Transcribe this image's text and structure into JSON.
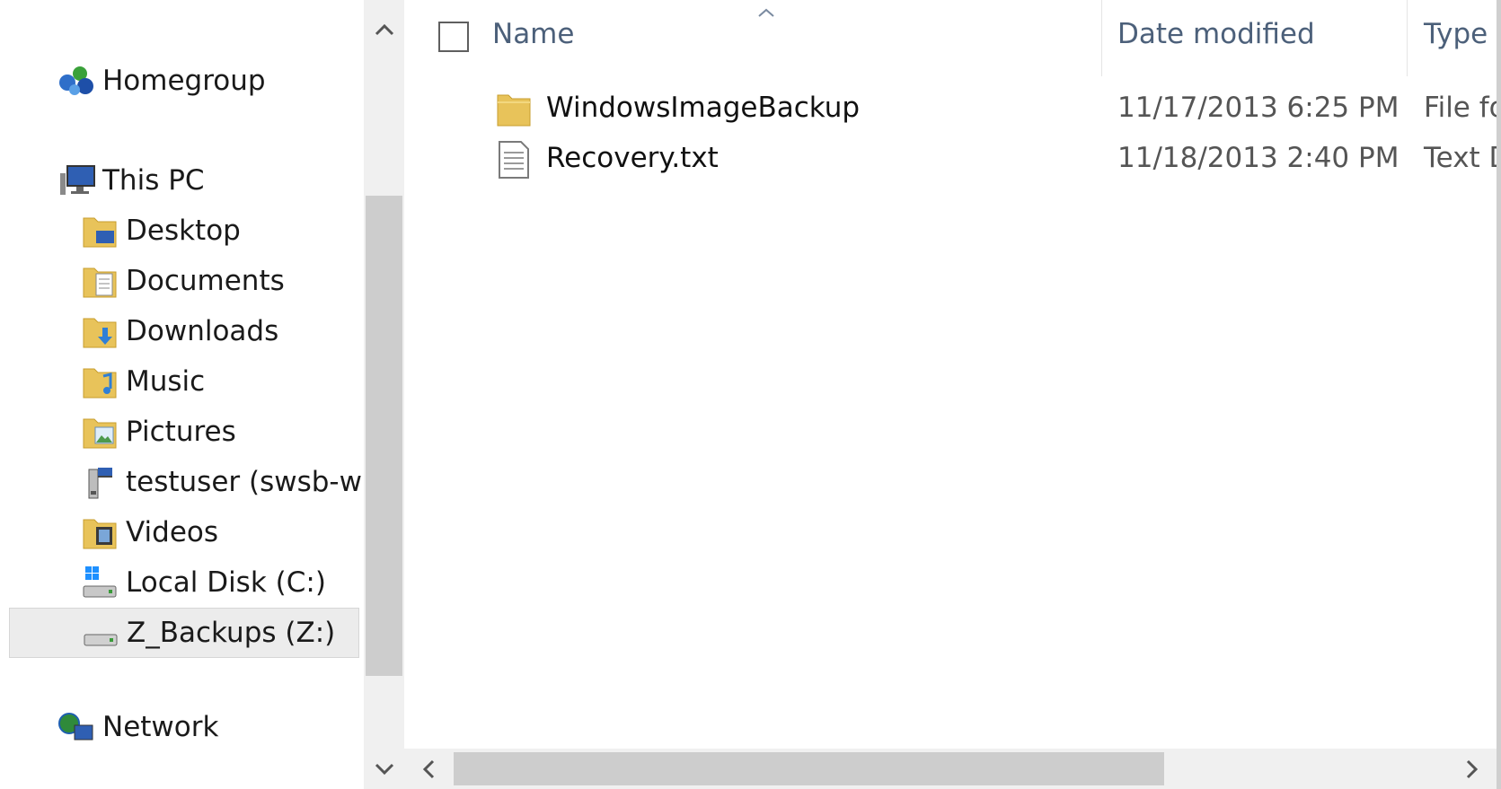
{
  "nav": {
    "items": [
      {
        "label": "Homegroup",
        "icon": "homegroup-icon",
        "level": 0
      },
      {
        "label": "This PC",
        "icon": "this-pc-icon",
        "level": 0
      },
      {
        "label": "Desktop",
        "icon": "desktop-folder-icon",
        "level": 1
      },
      {
        "label": "Documents",
        "icon": "documents-folder-icon",
        "level": 1
      },
      {
        "label": "Downloads",
        "icon": "downloads-folder-icon",
        "level": 1
      },
      {
        "label": "Music",
        "icon": "music-folder-icon",
        "level": 1
      },
      {
        "label": "Pictures",
        "icon": "pictures-folder-icon",
        "level": 1
      },
      {
        "label": "testuser (swsb-w",
        "icon": "network-drive-icon",
        "level": 1
      },
      {
        "label": "Videos",
        "icon": "videos-folder-icon",
        "level": 1
      },
      {
        "label": "Local Disk (C:)",
        "icon": "local-disk-icon",
        "level": 1
      },
      {
        "label": "Z_Backups (Z:)",
        "icon": "removable-drive-icon",
        "level": 1,
        "selected": true
      },
      {
        "label": "Network",
        "icon": "network-icon",
        "level": 0
      }
    ]
  },
  "columns": {
    "name": "Name",
    "date": "Date modified",
    "type": "Type"
  },
  "files": [
    {
      "name": "WindowsImageBackup",
      "date": "11/17/2013 6:25 PM",
      "type": "File fo",
      "icon": "folder-icon"
    },
    {
      "name": "Recovery.txt",
      "date": "11/18/2013 2:40 PM",
      "type": "Text D",
      "icon": "text-file-icon"
    }
  ],
  "scroll": {
    "up": "^",
    "down": "v",
    "left": "<",
    "right": ">"
  },
  "colors": {
    "folder": "#e8c35a",
    "header_text": "#4c607a",
    "selection": "#ececec"
  }
}
